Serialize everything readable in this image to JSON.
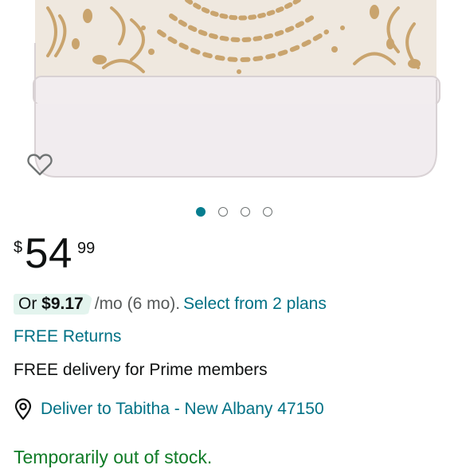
{
  "product_image": {
    "alt": ""
  },
  "carousel": {
    "count": 4,
    "active_index": 0
  },
  "price": {
    "symbol": "$",
    "whole": "54",
    "fraction": "99"
  },
  "monthly": {
    "prefix": "Or ",
    "amount": "$9.17",
    "term": "/mo (6 mo).",
    "plans_link": "Select from 2 plans"
  },
  "returns": {
    "label": "FREE Returns"
  },
  "delivery": {
    "text": "FREE delivery for Prime members"
  },
  "deliver_to": {
    "label": "Deliver to Tabitha - New Albany 47150",
    "icon": "location-pin-icon"
  },
  "availability": {
    "text": "Temporarily out of stock."
  },
  "colors": {
    "link": "#007185",
    "active_dot": "#067D8F",
    "pill_bg": "#E3F4EE",
    "stock_green": "#0F7B26"
  },
  "icons": {
    "wishlist": "heart-outline-icon"
  }
}
